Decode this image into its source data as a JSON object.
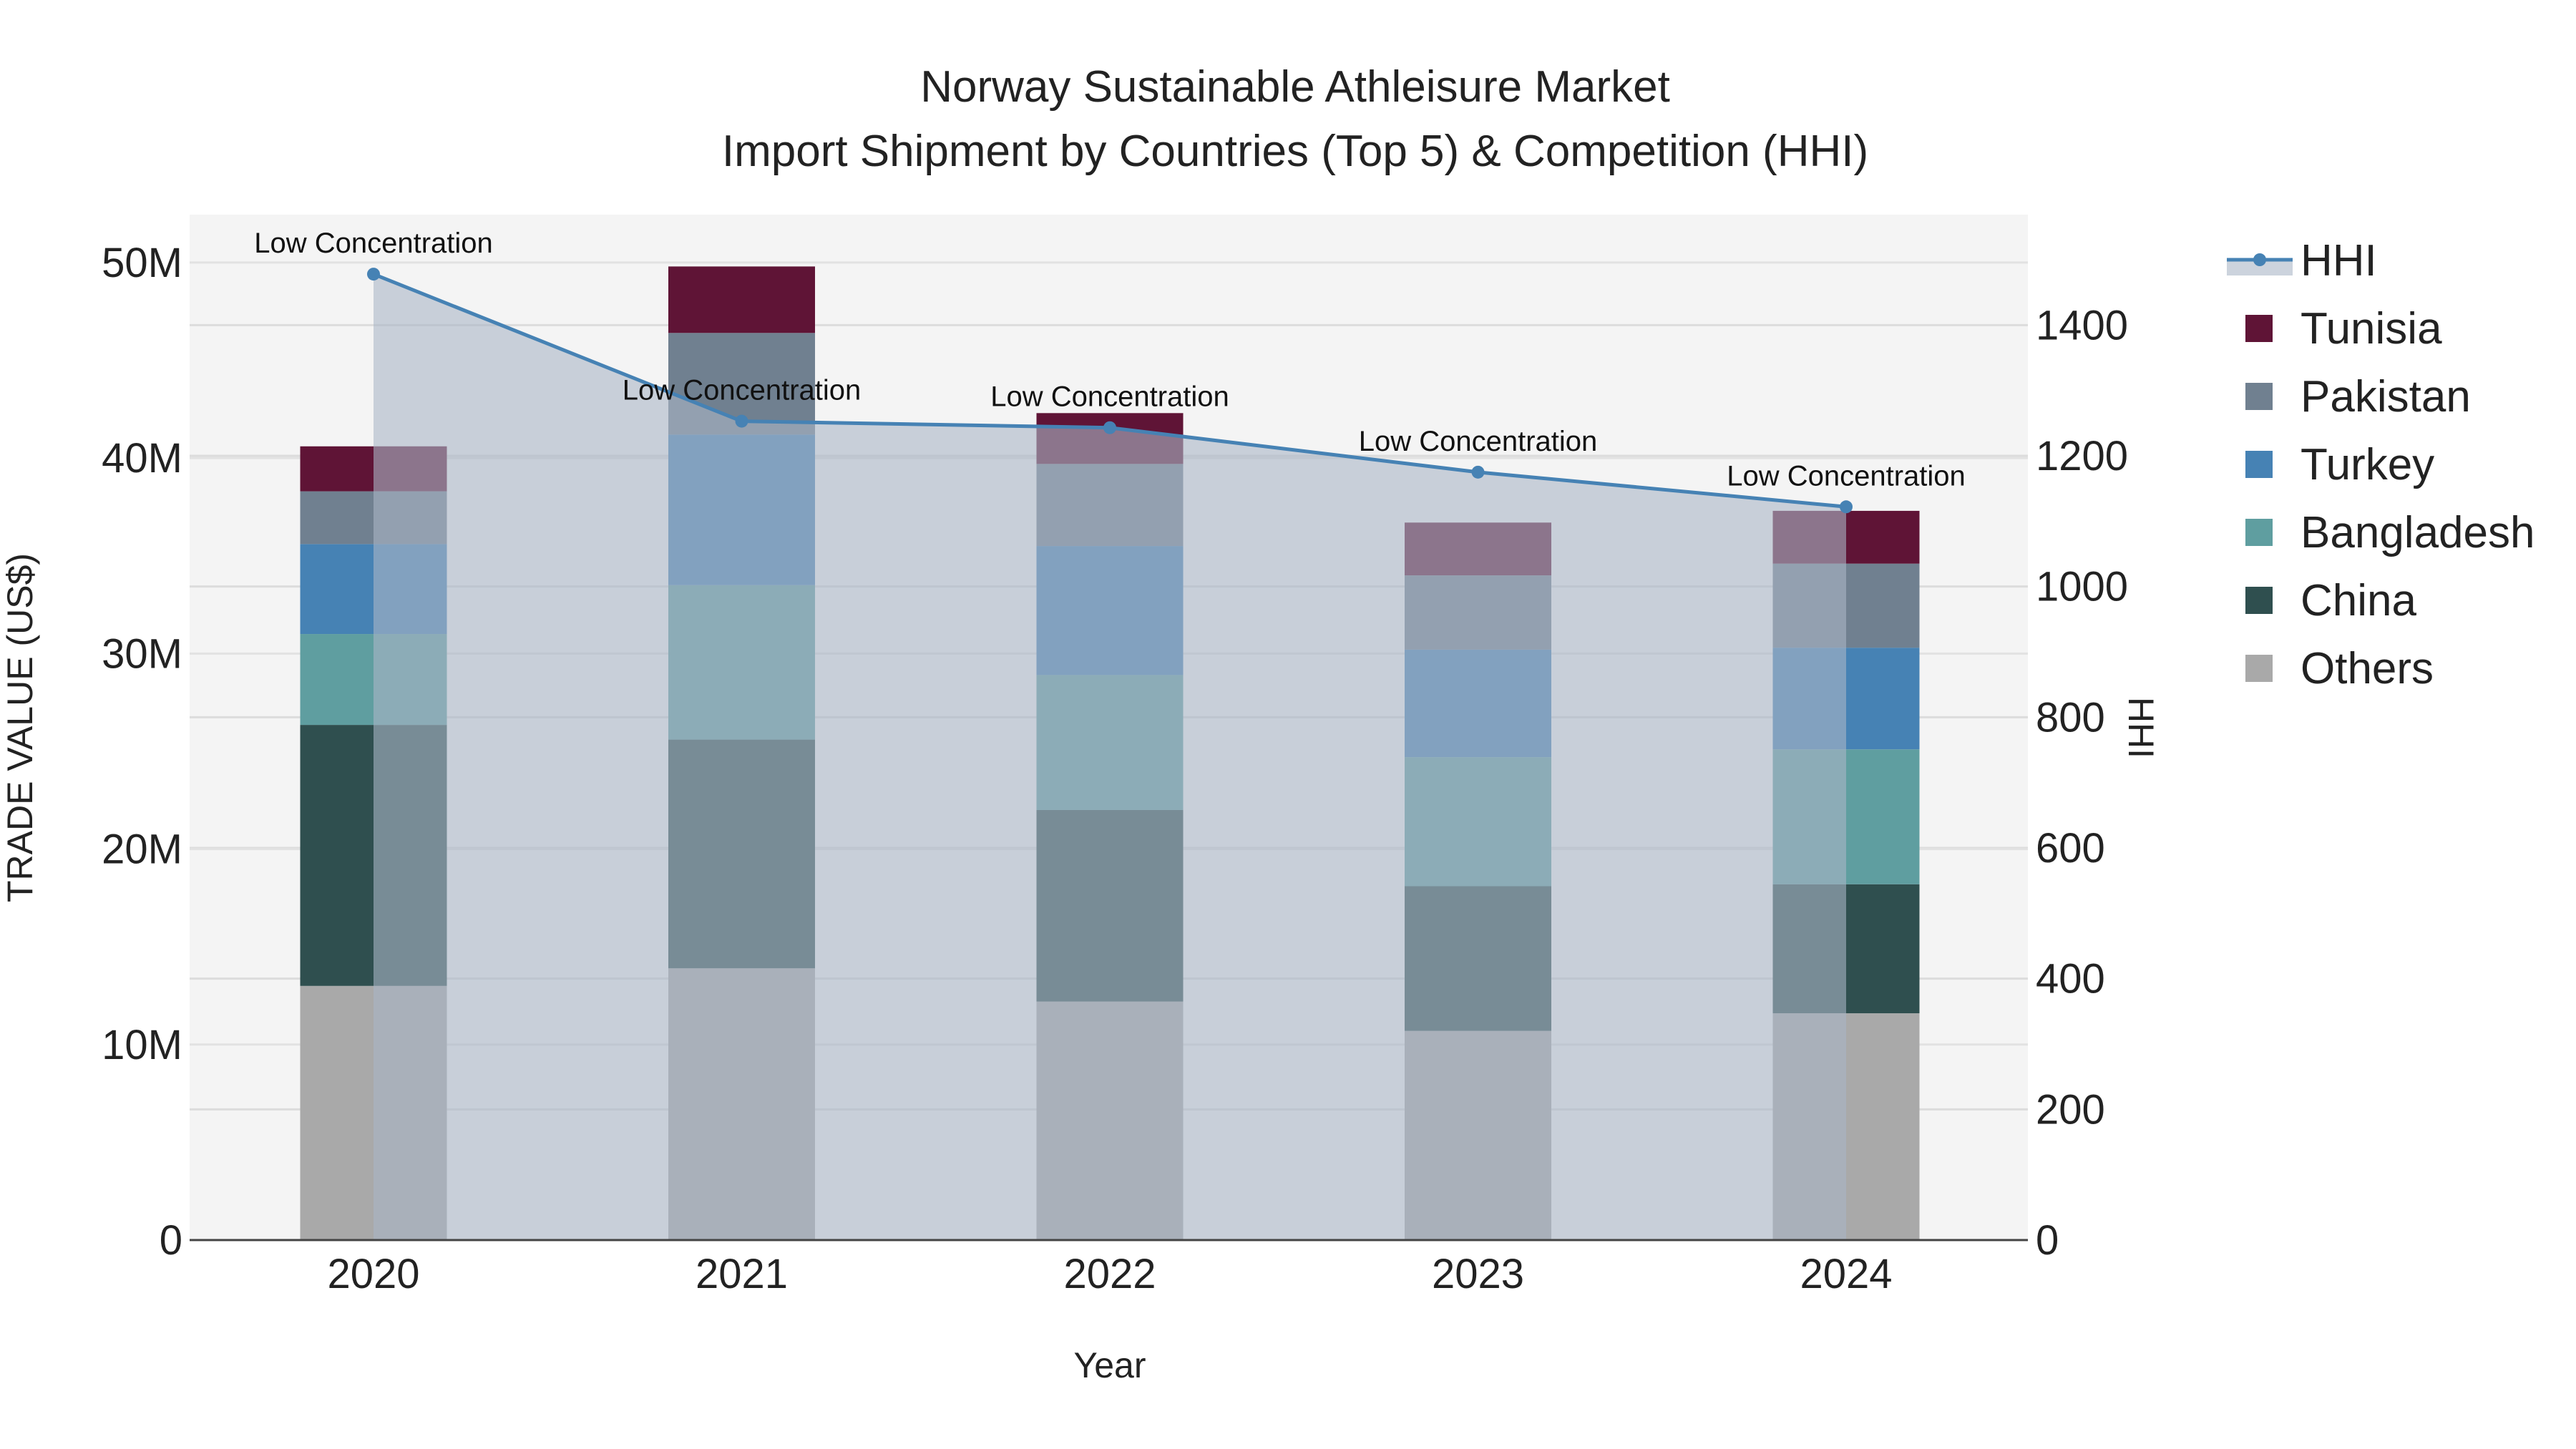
{
  "chart_data": {
    "type": "bar",
    "title": "Norway Sustainable Athleisure Market",
    "subtitle": "Import Shipment by Countries (Top 5) & Competition (HHI)",
    "xlabel": "Year",
    "ylabel": "TRADE VALUE (US$)",
    "y2label": "HHI",
    "categories": [
      "2020",
      "2021",
      "2022",
      "2023",
      "2024"
    ],
    "ylim": [
      0,
      52.45
    ],
    "y2lim": [
      0,
      1569
    ],
    "yticks": [
      {
        "v": 0,
        "label": "0"
      },
      {
        "v": 10,
        "label": "10M"
      },
      {
        "v": 20,
        "label": "20M"
      },
      {
        "v": 30,
        "label": "30M"
      },
      {
        "v": 40,
        "label": "40M"
      },
      {
        "v": 50,
        "label": "50M"
      }
    ],
    "y2ticks": [
      {
        "v": 0,
        "label": "0"
      },
      {
        "v": 200,
        "label": "200"
      },
      {
        "v": 400,
        "label": "400"
      },
      {
        "v": 600,
        "label": "600"
      },
      {
        "v": 800,
        "label": "800"
      },
      {
        "v": 1000,
        "label": "1000"
      },
      {
        "v": 1200,
        "label": "1200"
      },
      {
        "v": 1400,
        "label": "1400"
      }
    ],
    "grid": true,
    "legend_placement": "right",
    "series": [
      {
        "name": "Others",
        "color": "#a9a9a9",
        "values": [
          13.0,
          13.9,
          12.2,
          10.7,
          11.6
        ]
      },
      {
        "name": "China",
        "color": "#2f4f4f",
        "values": [
          13.35,
          11.7,
          9.8,
          7.4,
          6.6
        ]
      },
      {
        "name": "Bangladesh",
        "color": "#5f9ea0",
        "values": [
          4.65,
          7.9,
          6.9,
          6.6,
          6.9
        ]
      },
      {
        "name": "Turkey",
        "color": "#4682b4",
        "values": [
          4.6,
          7.7,
          6.6,
          5.5,
          5.2
        ]
      },
      {
        "name": "Pakistan",
        "color": "#708090",
        "values": [
          2.7,
          5.2,
          4.2,
          3.8,
          4.3
        ]
      },
      {
        "name": "Tunisia",
        "color": "#5f1436",
        "values": [
          2.3,
          3.4,
          2.6,
          2.7,
          2.7
        ]
      }
    ],
    "hhi": {
      "name": "HHI",
      "color": "#4682b4",
      "values": [
        1478,
        1253,
        1243,
        1175,
        1122
      ],
      "annotations": [
        "Low Concentration",
        "Low Concentration",
        "Low Concentration",
        "Low Concentration",
        "Low Concentration"
      ]
    },
    "legend_order": [
      "HHI",
      "Tunisia",
      "Pakistan",
      "Turkey",
      "Bangladesh",
      "China",
      "Others"
    ]
  }
}
